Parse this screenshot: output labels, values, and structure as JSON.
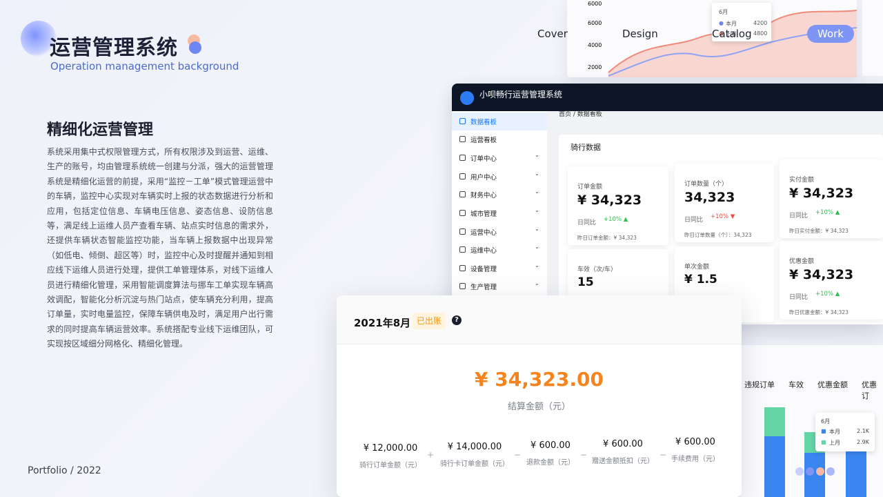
{
  "header": {
    "title": "运营管理系统",
    "subtitle": "Operation management background",
    "nav": [
      "Cover",
      "Design",
      "Catalog",
      "Work"
    ]
  },
  "intro": {
    "heading": "精细化运营管理",
    "body": "系统采用集中式权限管理方式，所有权限涉及到运营、运维、生产的账号，均由管理系统统一创建与分派，强大的运营管理系统是精细化运营的前提，采用“监控－工单”模式管理运营中的车辆，监控中心实现对车辆实时上报的状态数据进行分析和应用，包括定位信息、车辆电压信息、姿态信息、设防信息等，满足线上运维人员产查看车辆、站点实时信息的需求外，还提供车辆状态智能监控功能，当车辆上报数据中出现异常（如低电、倾倒、超区等）时，监控中心及时提醒并通知到相应线下运维人员进行处理，提供工单管理体系，对线下运维人员进行精细化管理，采用智能调度算法与挪车工单实现车辆高效调配，智能化分析沉淀与热门站点，使车辆充分利用，提高订单量，实时电量监控，保障车辆供电及时，满足用户出行需求的同时提高车辆运营效率。系统搭配专业线下运维团队，可实现按区域细分网格化、精细化管理。"
  },
  "footer": {
    "portfolio": "Portfolio / 2022"
  },
  "bg_chart": {
    "y_ticks": [
      "6000",
      "4000",
      "2000"
    ],
    "tooltip": {
      "month": "6月",
      "rows": [
        {
          "label": "本月",
          "value": "4200"
        },
        {
          "label": "上月",
          "value": "4800"
        }
      ]
    }
  },
  "admin": {
    "app_title": "小呗畅行运营管理系统",
    "breadcrumb": "首页 / 数据看板",
    "menu": [
      {
        "label": "数据看板",
        "active": true,
        "expandable": false
      },
      {
        "label": "运营看板",
        "active": false,
        "expandable": false
      },
      {
        "label": "订单中心",
        "active": false,
        "expandable": true
      },
      {
        "label": "用户中心",
        "active": false,
        "expandable": true
      },
      {
        "label": "财务中心",
        "active": false,
        "expandable": true
      },
      {
        "label": "城市管理",
        "active": false,
        "expandable": true
      },
      {
        "label": "运营中心",
        "active": false,
        "expandable": true
      },
      {
        "label": "运维中心",
        "active": false,
        "expandable": true
      },
      {
        "label": "设备管理",
        "active": false,
        "expandable": true
      },
      {
        "label": "生产管理",
        "active": false,
        "expandable": true
      }
    ],
    "section_title": "骑行数据",
    "stats": [
      {
        "title": "订单金额",
        "value": "¥ 34,323",
        "cmp": "日同比",
        "pct": "+10%",
        "dir": "up",
        "yest": "昨日订单金额：¥ 34,323"
      },
      {
        "title": "订单数量（个）",
        "value": "34,323",
        "cmp": "日同比",
        "pct": "+10%",
        "dir": "down",
        "yest": "昨日订单数量（个）：34,323"
      },
      {
        "title": "实付金额",
        "value": "¥ 34,323",
        "cmp": "日同比",
        "pct": "+10%",
        "dir": "up",
        "yest": "昨日实付金额：¥ 34,323"
      },
      {
        "title": "车效（次/车）",
        "value": "15"
      },
      {
        "title": "单次金额",
        "value": "¥ 1.5"
      },
      {
        "title": "优惠金额",
        "value": "¥ 34,323",
        "cmp": "日同比",
        "pct": "+10%",
        "dir": "up",
        "yest": "昨日优惠金额：¥ 34,323"
      }
    ]
  },
  "bill": {
    "month": "2021年8月",
    "status": "已出账",
    "help": "?",
    "total": "¥ 34,323.00",
    "total_label": "结算金额（元）",
    "items": [
      {
        "amount": "¥ 12,000.00",
        "label": "骑行订单金额（元）"
      },
      {
        "amount": "¥ 14,000.00",
        "label": "骑行卡订单金额（元）"
      },
      {
        "amount": "¥ 600.00",
        "label": "退款金额（元）"
      },
      {
        "amount": "¥ 600.00",
        "label": "赠送金额抵扣（元）"
      },
      {
        "amount": "¥ 600.00",
        "label": "手续费用（元）"
      }
    ],
    "operators": [
      "+",
      "−",
      "−",
      "−"
    ]
  },
  "right_panel": {
    "tabs": [
      "违规订单",
      "车效",
      "优惠金额",
      "优惠订"
    ],
    "tooltip": {
      "month": "6月",
      "rows": [
        {
          "label": "本月",
          "value": "2.1K"
        },
        {
          "label": "上月",
          "value": "2.9K"
        }
      ]
    }
  },
  "colors": {
    "accent": "#7f95f5",
    "admin_primary": "#1677ff",
    "bill_amount": "#f5841f",
    "badge": "#f29a1a",
    "up": "#2bbf4f",
    "down": "#f5443e"
  }
}
